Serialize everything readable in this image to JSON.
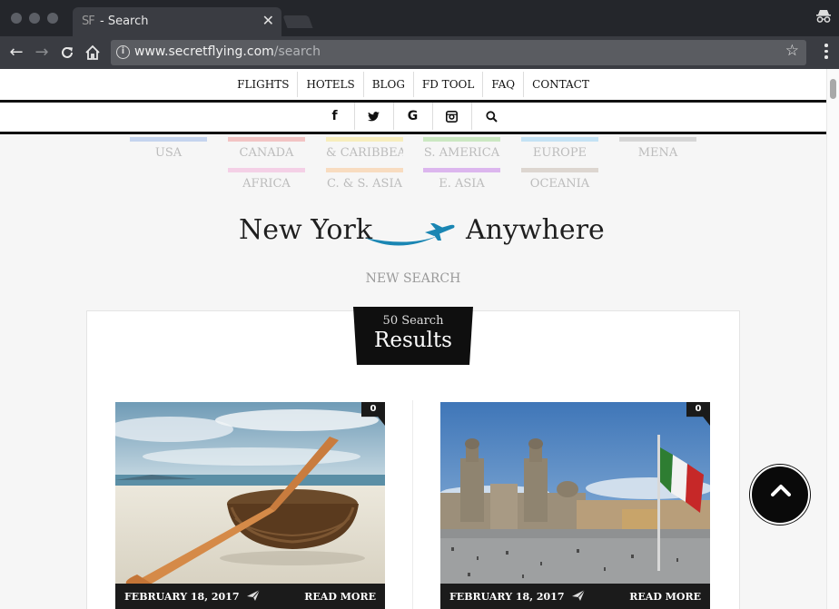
{
  "browser": {
    "tab": {
      "favicon_text": "SF",
      "title": "- Search"
    },
    "address": {
      "host": "www.secretflying.com",
      "path": "/search"
    }
  },
  "nav": {
    "menu": [
      "FLIGHTS",
      "HOTELS",
      "BLOG",
      "FD TOOL",
      "FAQ",
      "CONTACT"
    ],
    "social": [
      "f",
      "t",
      "G",
      "ig",
      "search"
    ]
  },
  "regions": [
    {
      "label": "USA",
      "color": "#c5d4ee"
    },
    {
      "label": "CANADA",
      "color": "#f2c4c4"
    },
    {
      "label": "& CARIBBEAN",
      "color": "#f7edbc"
    },
    {
      "label": "S. AMERICA",
      "color": "#cbe8c2"
    },
    {
      "label": "EUROPE",
      "color": "#c4e2f4"
    },
    {
      "label": "MENA",
      "color": "#d6d6d6"
    },
    {
      "label": "AFRICA",
      "color": "#f4d0e6"
    },
    {
      "label": "C. & S. ASIA",
      "color": "#f8dcc0"
    },
    {
      "label": "E. ASIA",
      "color": "#dcb6ee"
    },
    {
      "label": "OCEANIA",
      "color": "#ddd6d0"
    }
  ],
  "route": {
    "from": "New York",
    "to": "Anywhere",
    "accent": "#1a86b3"
  },
  "new_search": "NEW SEARCH",
  "results": {
    "count_label": "50 Search",
    "word": "Results"
  },
  "cards": [
    {
      "count": "0",
      "date": "FEBRUARY 18, 2017",
      "read_more": "READ MORE",
      "image": "basket-boat-beach"
    },
    {
      "count": "0",
      "date": "FEBRUARY 18, 2017",
      "read_more": "READ MORE",
      "image": "mexico-city-cathedral"
    }
  ]
}
